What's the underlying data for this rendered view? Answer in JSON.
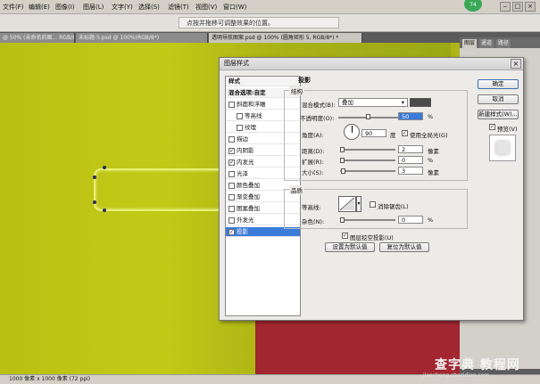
{
  "menu": [
    "文件(F)",
    "编辑(E)",
    "图像(I)",
    "图层(L)",
    "文字(Y)",
    "选择(S)",
    "滤镜(T)",
    "视图(V)",
    "窗口(W)"
  ],
  "badge": "74",
  "options": {
    "tip": "点按并拖移可调整效果的位置。"
  },
  "tabs": [
    "@ 50% (未命名的图... RGB/8*)",
    "未标题-5.psd @ 100%(RGB/8*)",
    "透明导航图案.psd @ 100% (圆角矩形 5, RGB/8*) *"
  ],
  "right_panel": {
    "tabs": [
      "图层",
      "通道",
      "路径"
    ]
  },
  "dialog": {
    "title": "图层样式",
    "style_list": [
      {
        "label": "样式",
        "checked": null,
        "head": true
      },
      {
        "label": "混合选项:自定",
        "checked": null,
        "head": true
      },
      {
        "label": "斜面和浮雕",
        "checked": false
      },
      {
        "label": "等高线",
        "checked": false,
        "indent": true
      },
      {
        "label": "纹理",
        "checked": false,
        "indent": true
      },
      {
        "label": "描边",
        "checked": false
      },
      {
        "label": "内阴影",
        "checked": true
      },
      {
        "label": "内发光",
        "checked": true
      },
      {
        "label": "光泽",
        "checked": false
      },
      {
        "label": "颜色叠加",
        "checked": false
      },
      {
        "label": "渐变叠加",
        "checked": false
      },
      {
        "label": "图案叠加",
        "checked": false
      },
      {
        "label": "外发光",
        "checked": false
      },
      {
        "label": "投影",
        "checked": true,
        "selected": true
      }
    ],
    "section_title": "投影",
    "structure": {
      "legend": "结构",
      "blend_mode_label": "混合模式(B):",
      "blend_mode_value": "叠加",
      "opacity_label": "不透明度(O):",
      "opacity_value": "50",
      "opacity_fraction": 0.5,
      "percent": "%",
      "angle_label": "角度(A):",
      "angle_value": "90",
      "angle_unit": "度",
      "global_light_label": "使用全局光(G)",
      "global_light_checked": true,
      "distance_label": "距离(D):",
      "distance_value": "2",
      "spread_label": "扩展(R):",
      "spread_value": "0",
      "size_label": "大小(S):",
      "size_value": "3",
      "px": "像素"
    },
    "quality": {
      "legend": "品质",
      "contour_label": "等高线:",
      "antialias_label": "消除锯齿(L)",
      "noise_label": "杂色(N):",
      "noise_value": "0",
      "percent": "%"
    },
    "knockout_label": "图层挖空投影(U)",
    "default_button": "设置为默认值",
    "reset_button": "复位为默认值",
    "ok_button": "确定",
    "cancel_button": "取消",
    "new_style_button": "新建样式(W)...",
    "preview_label": "预览(V)",
    "preview_checked": true
  },
  "status": "1000 像素 x 1000 像素 (72 ppi)",
  "watermark": {
    "main": "查字典 教程网",
    "sub": "jiaocheng.chazidian.com"
  },
  "colors": {
    "canvas": "#bcc215",
    "red_layer": "#a1262f",
    "selection": "#3b7bd9"
  }
}
